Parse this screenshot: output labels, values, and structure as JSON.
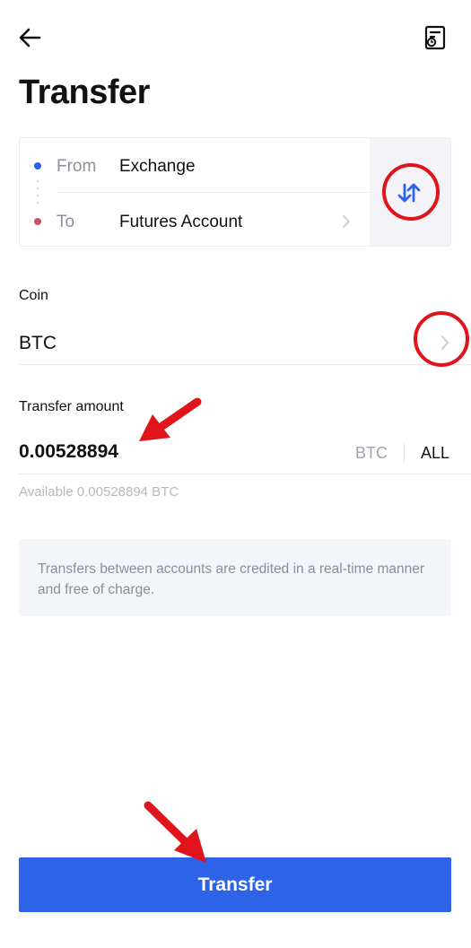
{
  "header": {
    "title": "Transfer"
  },
  "transfer": {
    "from_label": "From",
    "from_value": "Exchange",
    "to_label": "To",
    "to_value": "Futures Account"
  },
  "coin": {
    "label": "Coin",
    "value": "BTC"
  },
  "amount": {
    "label": "Transfer amount",
    "value": "0.00528894",
    "unit": "BTC",
    "all_label": "ALL",
    "available": "Available 0.00528894 BTC"
  },
  "notice": "Transfers between accounts are credited in a real-time manner and free of charge.",
  "primary_button": "Transfer",
  "colors": {
    "accent": "#2d63e6",
    "from_dot": "#2d63e6",
    "to_dot": "#c4566a",
    "annotation": "#e0141b"
  },
  "icons": [
    "back-arrow-icon",
    "history-icon",
    "swap-icon",
    "chevron-right-icon"
  ]
}
